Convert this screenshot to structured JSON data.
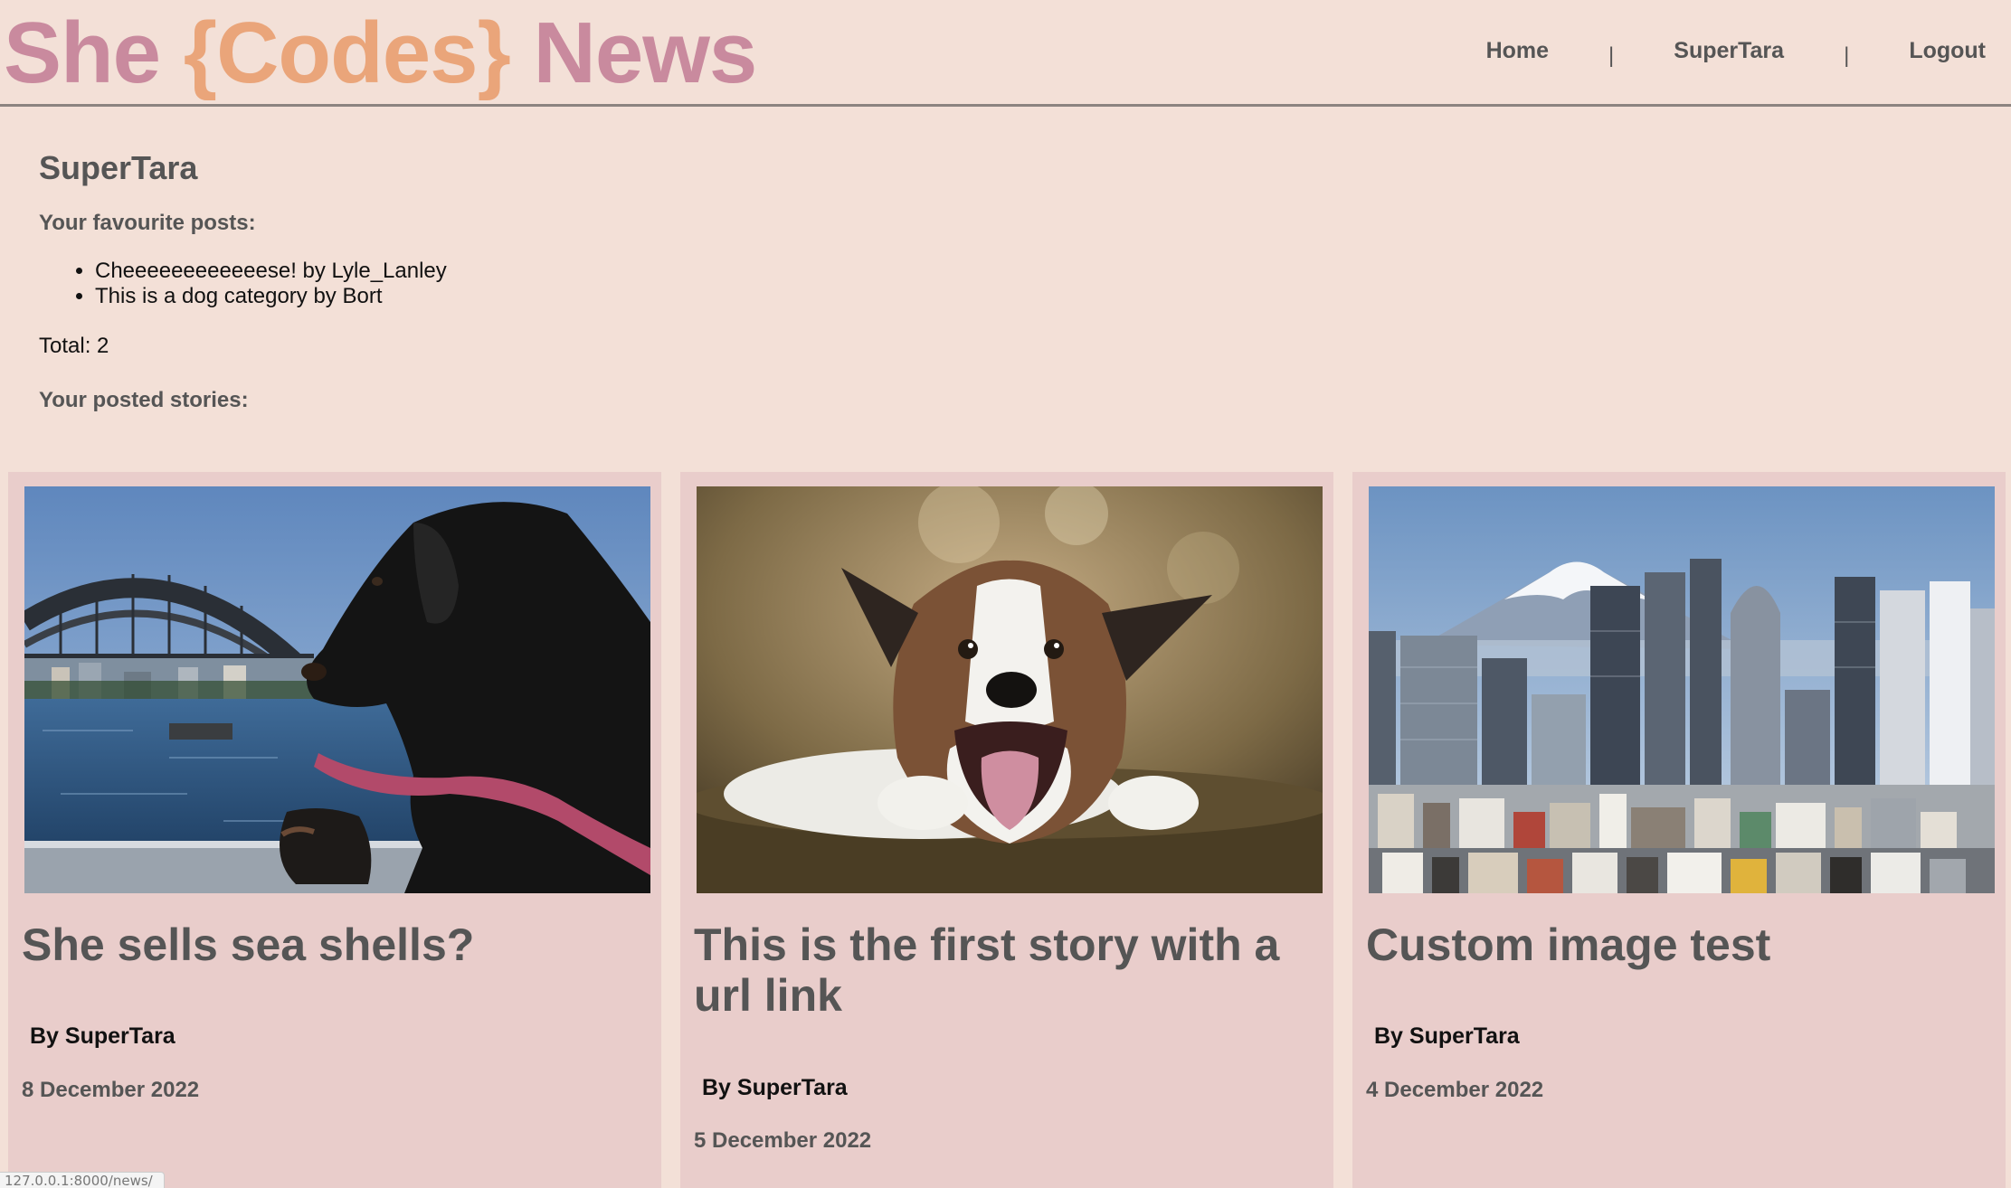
{
  "brand": {
    "part1": "She",
    "part2": "{Codes}",
    "part3": "News"
  },
  "nav": {
    "home": "Home",
    "user": "SuperTara",
    "logout": "Logout",
    "separator": "|"
  },
  "profile": {
    "username": "SuperTara",
    "favourites_label": "Your favourite posts:",
    "favourites": [
      "Cheeeeeeeeeeeese! by Lyle_Lanley",
      "This is a dog category by Bort"
    ],
    "total": "Total: 2",
    "stories_label": "Your posted stories:"
  },
  "stories": [
    {
      "title": "She sells sea shells?",
      "author": "By SuperTara",
      "date": "8 December 2022",
      "image": "dachshund-harbour-bridge"
    },
    {
      "title": "This is the first story with a url link",
      "author": "By SuperTara",
      "date": "5 December 2022",
      "image": "border-collie-smiling"
    },
    {
      "title": "Custom image test",
      "author": "By SuperTara",
      "date": "4 December 2022",
      "image": "tokyo-skyline-mount-fuji"
    }
  ],
  "status_url": "127.0.0.1:8000/news/",
  "colors": {
    "background": "#f3e0d7",
    "card": "#e9cdcb",
    "brand_pink": "#c98a9e",
    "brand_orange": "#eaa57a",
    "text": "#555555"
  }
}
